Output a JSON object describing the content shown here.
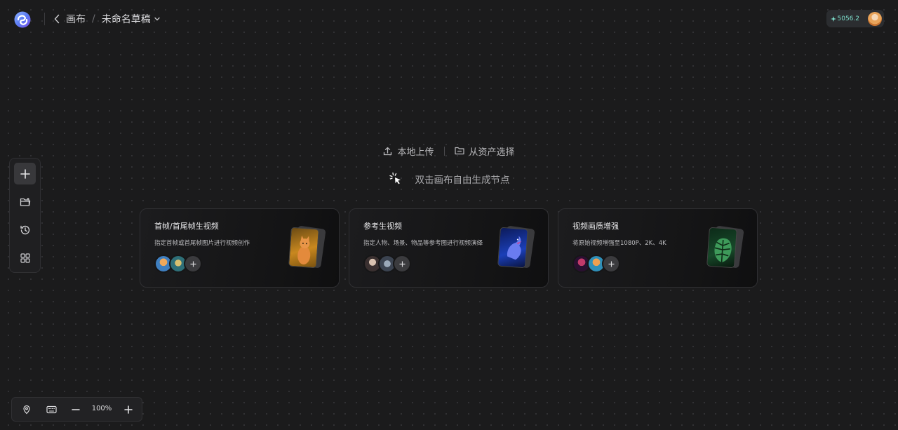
{
  "header": {
    "breadcrumb_canvas": "画布",
    "breadcrumb_separator": "/",
    "draft_title": "未命名草稿",
    "credits": "5056.2"
  },
  "canvas": {
    "upload_local": "本地上传",
    "select_from_assets": "从资产选择",
    "hint": "双击画布自由生成节点"
  },
  "cards": [
    {
      "title": "首帧/首尾帧生视频",
      "description": "指定首帧或首尾帧图片进行视频创作",
      "thumbnail": "orange-cat-image"
    },
    {
      "title": "参考生视频",
      "description": "指定人物、场景、物品等参考图进行视频演绎",
      "thumbnail": "blue-bird-image"
    },
    {
      "title": "视频画质增强",
      "description": "将原始视频增强至1080P、2K、4K",
      "thumbnail": "monstera-leaf-image"
    }
  ],
  "toolbar_icons": [
    "plus-icon",
    "folder-icon",
    "history-icon",
    "grid-icon"
  ],
  "bottom_bar": {
    "zoom": "100%"
  },
  "colors": {
    "background": "#1b1b1c",
    "credits_accent": "#7fe3cf",
    "logo_accent": "#5b7cf5"
  }
}
